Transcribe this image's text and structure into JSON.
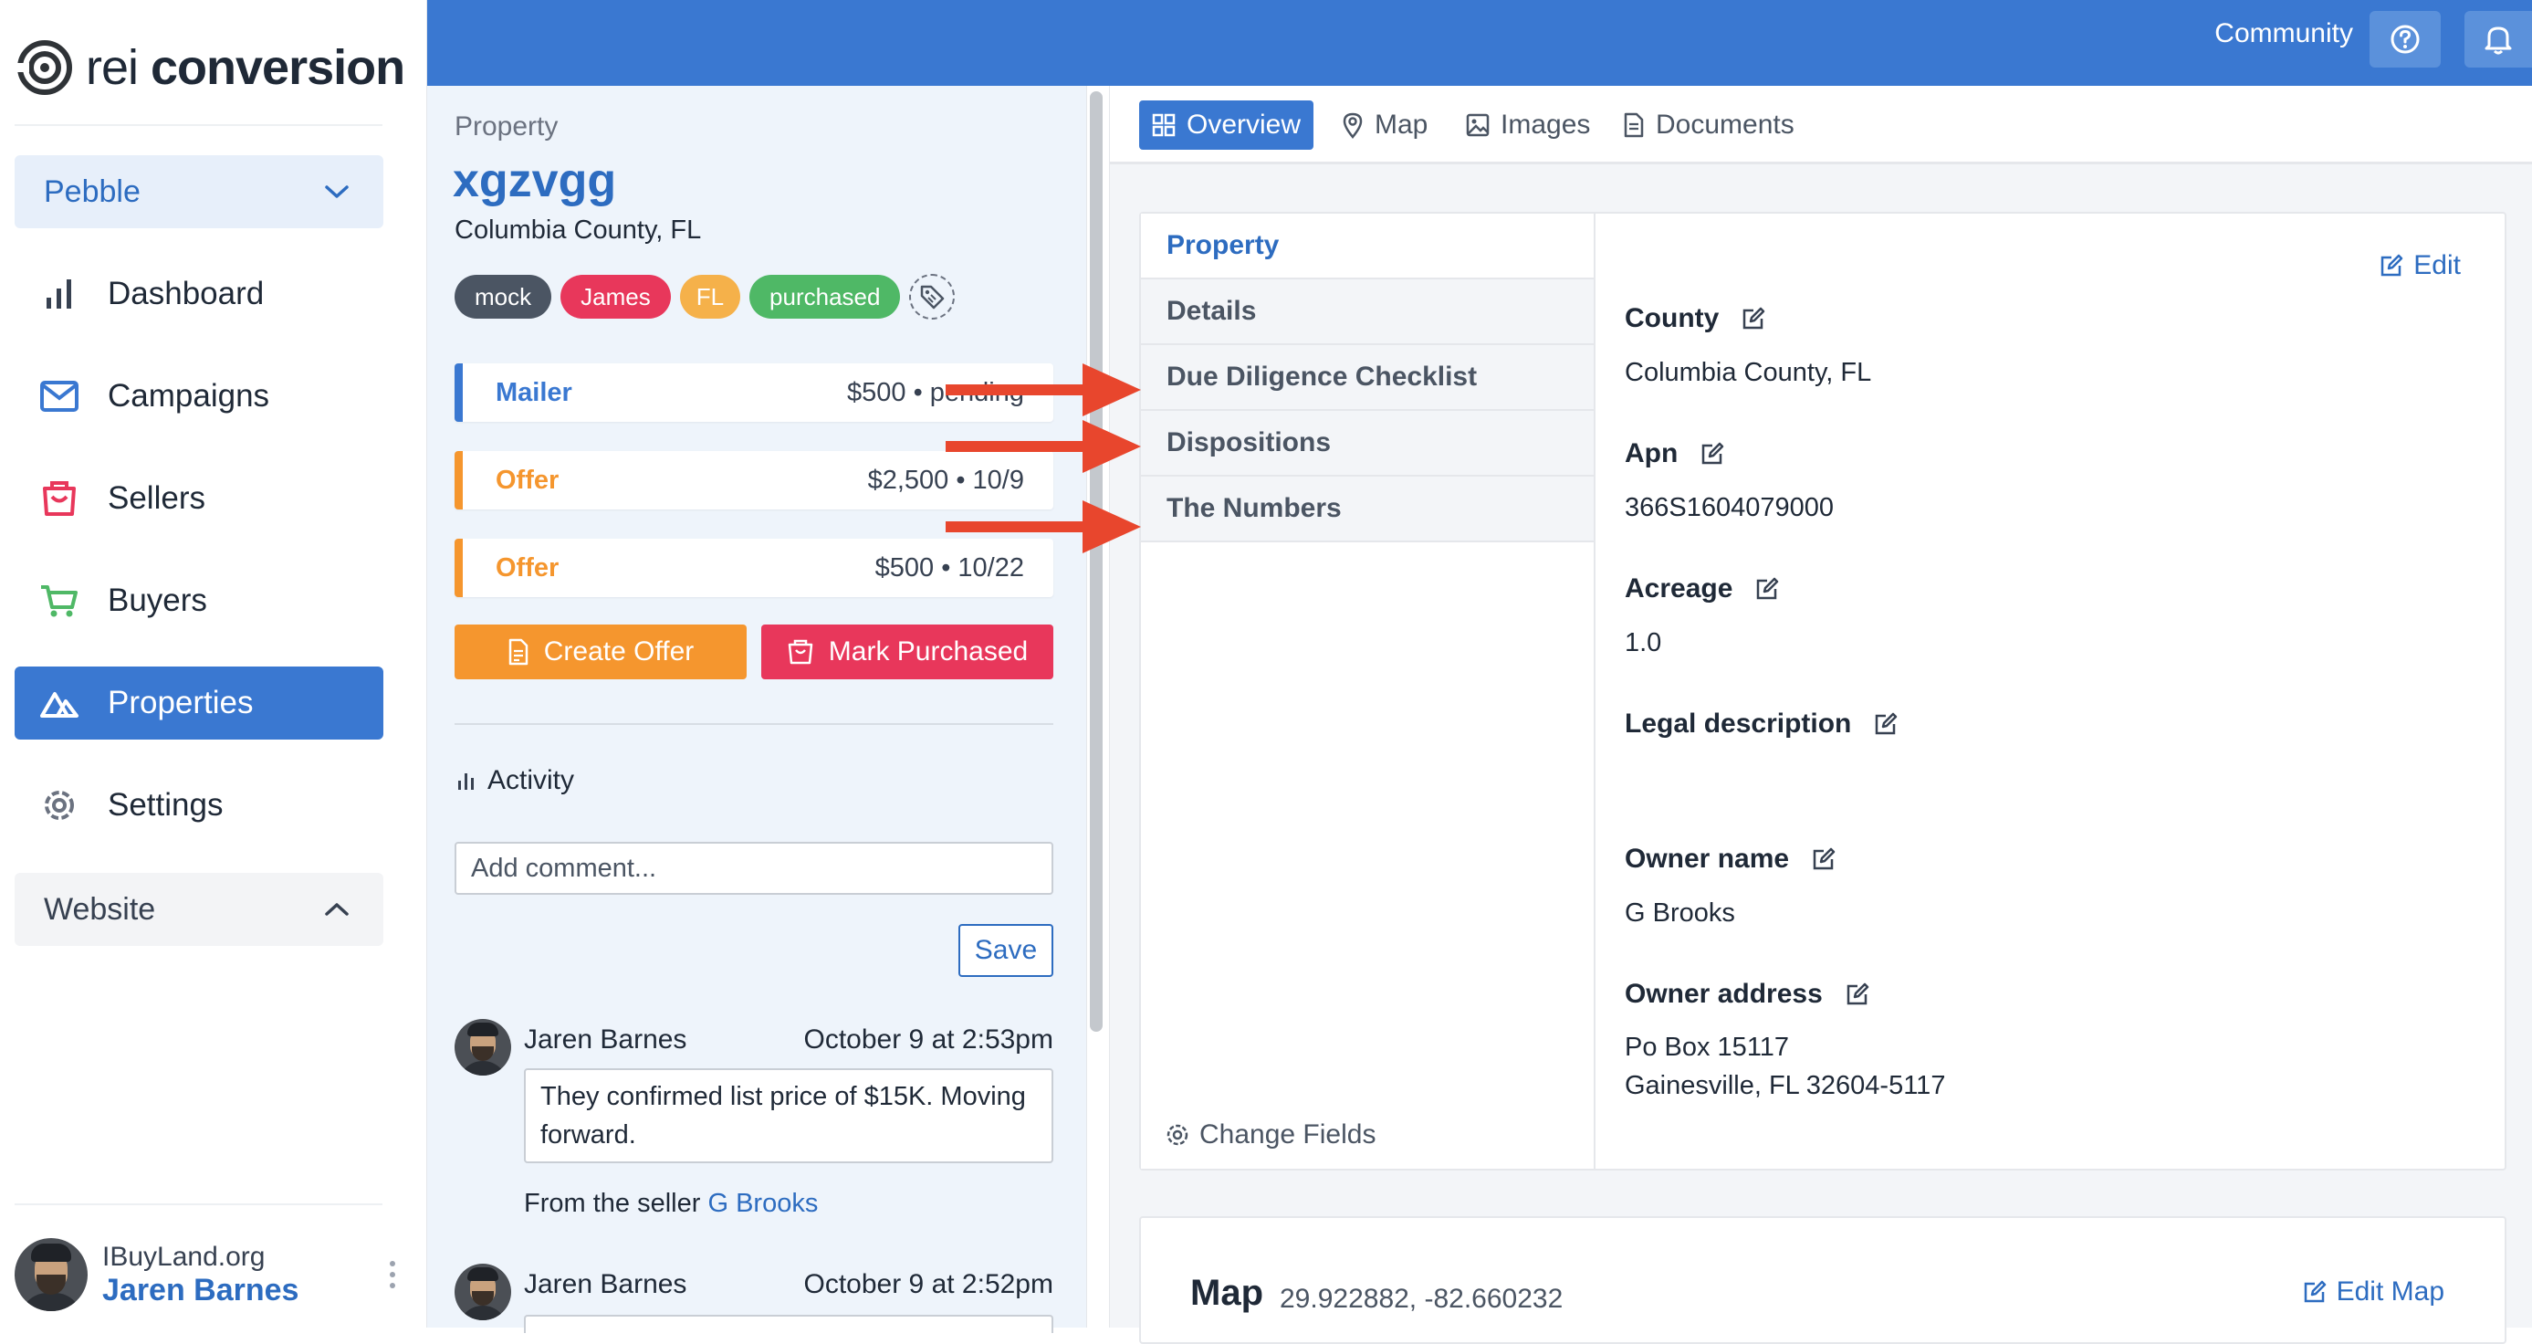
{
  "brand": {
    "light": "rei ",
    "bold": "conversion"
  },
  "sidebar": {
    "workspace": "Pebble",
    "items": [
      {
        "label": "Dashboard",
        "icon": "bar-chart-icon"
      },
      {
        "label": "Campaigns",
        "icon": "mail-icon"
      },
      {
        "label": "Sellers",
        "icon": "shopping-bag-icon"
      },
      {
        "label": "Buyers",
        "icon": "cart-icon"
      },
      {
        "label": "Properties",
        "icon": "mountain-icon",
        "active": true
      },
      {
        "label": "Settings",
        "icon": "gear-icon"
      }
    ],
    "website_section": "Website",
    "user": {
      "org": "IBuyLand.org",
      "name": "Jaren Barnes"
    }
  },
  "topbar": {
    "community": "Community"
  },
  "property": {
    "label": "Property",
    "name": "xgzvgg",
    "county": "Columbia County, FL",
    "tags": [
      {
        "label": "mock",
        "color": "#4b5563"
      },
      {
        "label": "James",
        "color": "#e8375b"
      },
      {
        "label": "FL",
        "color": "#f5b14a"
      },
      {
        "label": "purchased",
        "color": "#4fb866"
      }
    ],
    "events": [
      {
        "type": "Mailer",
        "detail": "$500 • pending",
        "color": "#3a78d1"
      },
      {
        "type": "Offer",
        "detail": "$2,500 • 10/9",
        "color": "#f5962e"
      },
      {
        "type": "Offer",
        "detail": "$500 • 10/22",
        "color": "#f5962e"
      }
    ],
    "create_offer": "Create Offer",
    "mark_purchased": "Mark Purchased"
  },
  "activity": {
    "title": "Activity",
    "placeholder": "Add comment...",
    "save": "Save",
    "comments": [
      {
        "author": "Jaren Barnes",
        "time": "October 9 at 2:53pm",
        "text": "They confirmed list price of $15K. Moving forward.",
        "from_prefix": "From the seller ",
        "from_link": "G Brooks"
      },
      {
        "author": "Jaren Barnes",
        "time": "October 9 at 2:52pm"
      }
    ]
  },
  "tabs": [
    "Overview",
    "Map",
    "Images",
    "Documents"
  ],
  "sections": [
    "Property",
    "Details",
    "Due Diligence Checklist",
    "Dispositions",
    "The Numbers"
  ],
  "change_fields": "Change Fields",
  "edit": "Edit",
  "fields": [
    {
      "label": "County",
      "value": "Columbia County, FL"
    },
    {
      "label": "Apn",
      "value": "366S1604079000"
    },
    {
      "label": "Acreage",
      "value": "1.0"
    },
    {
      "label": "Legal description",
      "value": ""
    },
    {
      "label": "Owner name",
      "value": "G Brooks"
    },
    {
      "label": "Owner address",
      "value_line1": "Po Box 15117",
      "value_line2": "Gainesville, FL 32604-5117"
    }
  ],
  "map": {
    "title": "Map",
    "coords": "29.922882, -82.660232",
    "edit": "Edit Map"
  },
  "colors": {
    "accent": "#3a78d1",
    "arrow": "#e8462d"
  }
}
